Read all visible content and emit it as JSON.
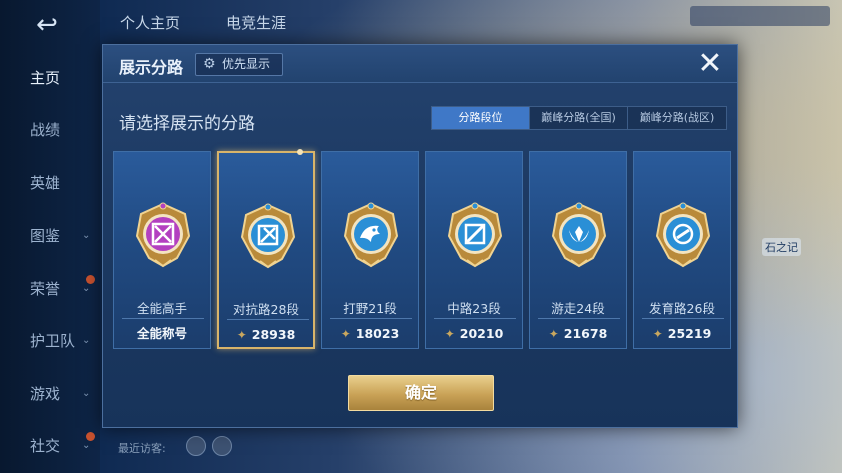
{
  "background": {
    "tabs": [
      "个人主页",
      "电竞生涯"
    ],
    "nav": [
      {
        "label": "主页",
        "chevron": false,
        "dot": false,
        "active": true
      },
      {
        "label": "战绩",
        "chevron": false,
        "dot": false,
        "active": false
      },
      {
        "label": "英雄",
        "chevron": false,
        "dot": false,
        "active": false
      },
      {
        "label": "图鉴",
        "chevron": true,
        "dot": false,
        "active": false
      },
      {
        "label": "荣誉",
        "chevron": true,
        "dot": true,
        "active": false
      },
      {
        "label": "护卫队",
        "chevron": true,
        "dot": false,
        "active": false
      },
      {
        "label": "游戏",
        "chevron": true,
        "dot": false,
        "active": false
      },
      {
        "label": "社交",
        "chevron": true,
        "dot": true,
        "active": false
      }
    ],
    "visitors_label": "最近访客:",
    "side_text": "石之记"
  },
  "dialog": {
    "title": "展示分路",
    "priority_label": "优先显示",
    "close_label": "✕",
    "subtitle": "请选择展示的分路",
    "tabs": [
      {
        "label": "分路段位",
        "active": true
      },
      {
        "label": "巅峰分路(全国)",
        "active": false
      },
      {
        "label": "巅峰分路(战区)",
        "active": false
      }
    ],
    "cards": [
      {
        "name": "全能高手",
        "footer": "全能称号",
        "points": false,
        "selected": false,
        "emblem": "allround",
        "color": "#b340c0"
      },
      {
        "name": "对抗路28段",
        "footer": "28938",
        "points": true,
        "selected": true,
        "emblem": "clash",
        "color": "#2a8fd6"
      },
      {
        "name": "打野21段",
        "footer": "18023",
        "points": true,
        "selected": false,
        "emblem": "jungle",
        "color": "#2a8fd6"
      },
      {
        "name": "中路23段",
        "footer": "20210",
        "points": true,
        "selected": false,
        "emblem": "mid",
        "color": "#2a8fd6"
      },
      {
        "name": "游走24段",
        "footer": "21678",
        "points": true,
        "selected": false,
        "emblem": "roam",
        "color": "#2a8fd6"
      },
      {
        "name": "发育路26段",
        "footer": "25219",
        "points": true,
        "selected": false,
        "emblem": "farm",
        "color": "#2a8fd6"
      }
    ],
    "confirm_label": "确定"
  }
}
